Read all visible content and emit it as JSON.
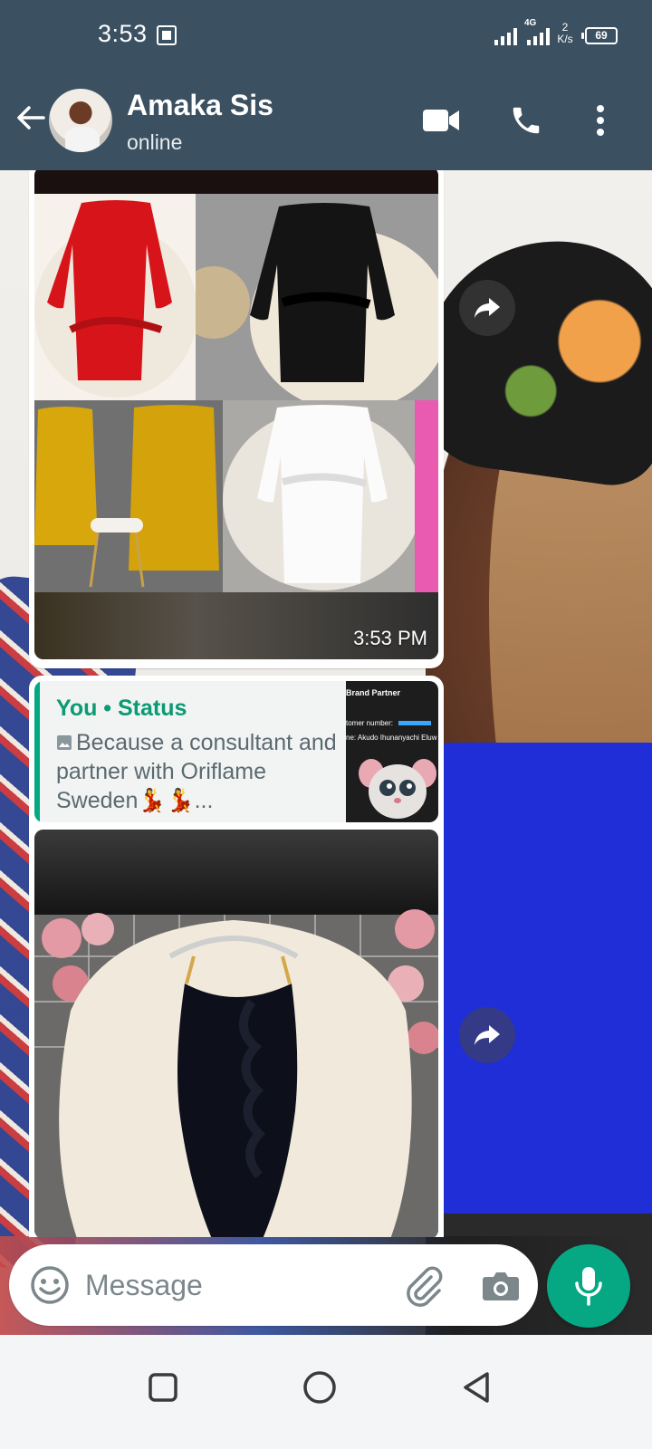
{
  "status_bar": {
    "time": "3:53",
    "network": "4G",
    "speed_value": "2",
    "speed_unit": "K/s",
    "battery": "69"
  },
  "header": {
    "contact_name": "Amaka Sis",
    "contact_status": "online",
    "icons": [
      "back-arrow-icon",
      "video-call-icon",
      "phone-icon",
      "more-vertical-icon"
    ],
    "color": "#3b5061"
  },
  "messages": [
    {
      "type": "image",
      "content": "collage of four wrap dresses: red, black, mustard yellow, white",
      "time": "3:53 PM"
    },
    {
      "type": "reply",
      "quote_title": "You • Status",
      "quote_text": "Because a consultant and partner with Oriflame Sweden💃💃...",
      "thumb_lines": [
        "Brand Partner",
        "tomer number:",
        "ne: Akudo Ihunanyachi Eluw"
      ],
      "content": "black ruffled spaghetti-strap dress on fur rug"
    }
  ],
  "composer": {
    "placeholder": "Message",
    "icons": [
      "emoji-icon",
      "attach-icon",
      "camera-icon",
      "mic-icon"
    ]
  },
  "colors": {
    "accent": "#06a884",
    "header": "#3b5061",
    "quote_title": "#0a9a74"
  }
}
